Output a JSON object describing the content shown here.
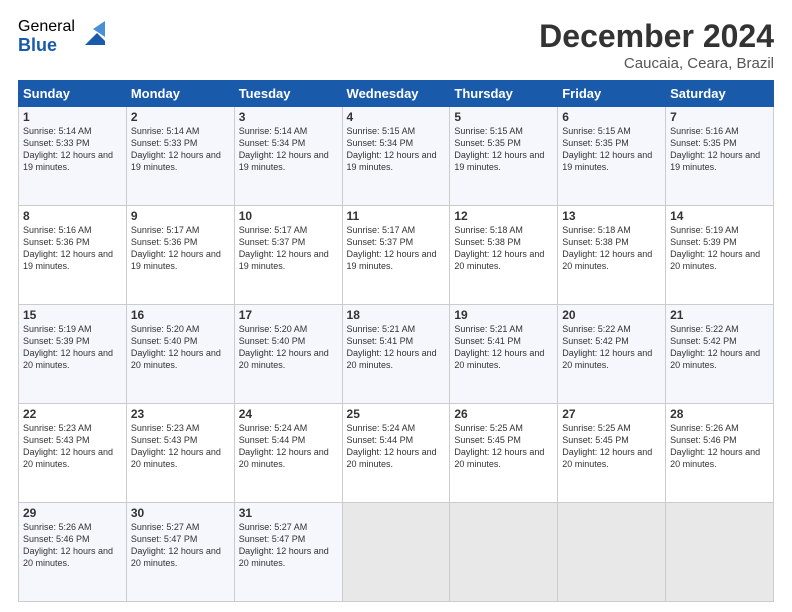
{
  "logo": {
    "general": "General",
    "blue": "Blue"
  },
  "title": "December 2024",
  "location": "Caucaia, Ceara, Brazil",
  "days_of_week": [
    "Sunday",
    "Monday",
    "Tuesday",
    "Wednesday",
    "Thursday",
    "Friday",
    "Saturday"
  ],
  "weeks": [
    [
      {
        "day": "1",
        "sunrise": "5:14 AM",
        "sunset": "5:33 PM",
        "daylight": "12 hours and 19 minutes."
      },
      {
        "day": "2",
        "sunrise": "5:14 AM",
        "sunset": "5:33 PM",
        "daylight": "12 hours and 19 minutes."
      },
      {
        "day": "3",
        "sunrise": "5:14 AM",
        "sunset": "5:34 PM",
        "daylight": "12 hours and 19 minutes."
      },
      {
        "day": "4",
        "sunrise": "5:15 AM",
        "sunset": "5:34 PM",
        "daylight": "12 hours and 19 minutes."
      },
      {
        "day": "5",
        "sunrise": "5:15 AM",
        "sunset": "5:35 PM",
        "daylight": "12 hours and 19 minutes."
      },
      {
        "day": "6",
        "sunrise": "5:15 AM",
        "sunset": "5:35 PM",
        "daylight": "12 hours and 19 minutes."
      },
      {
        "day": "7",
        "sunrise": "5:16 AM",
        "sunset": "5:35 PM",
        "daylight": "12 hours and 19 minutes."
      }
    ],
    [
      {
        "day": "8",
        "sunrise": "5:16 AM",
        "sunset": "5:36 PM",
        "daylight": "12 hours and 19 minutes."
      },
      {
        "day": "9",
        "sunrise": "5:17 AM",
        "sunset": "5:36 PM",
        "daylight": "12 hours and 19 minutes."
      },
      {
        "day": "10",
        "sunrise": "5:17 AM",
        "sunset": "5:37 PM",
        "daylight": "12 hours and 19 minutes."
      },
      {
        "day": "11",
        "sunrise": "5:17 AM",
        "sunset": "5:37 PM",
        "daylight": "12 hours and 19 minutes."
      },
      {
        "day": "12",
        "sunrise": "5:18 AM",
        "sunset": "5:38 PM",
        "daylight": "12 hours and 20 minutes."
      },
      {
        "day": "13",
        "sunrise": "5:18 AM",
        "sunset": "5:38 PM",
        "daylight": "12 hours and 20 minutes."
      },
      {
        "day": "14",
        "sunrise": "5:19 AM",
        "sunset": "5:39 PM",
        "daylight": "12 hours and 20 minutes."
      }
    ],
    [
      {
        "day": "15",
        "sunrise": "5:19 AM",
        "sunset": "5:39 PM",
        "daylight": "12 hours and 20 minutes."
      },
      {
        "day": "16",
        "sunrise": "5:20 AM",
        "sunset": "5:40 PM",
        "daylight": "12 hours and 20 minutes."
      },
      {
        "day": "17",
        "sunrise": "5:20 AM",
        "sunset": "5:40 PM",
        "daylight": "12 hours and 20 minutes."
      },
      {
        "day": "18",
        "sunrise": "5:21 AM",
        "sunset": "5:41 PM",
        "daylight": "12 hours and 20 minutes."
      },
      {
        "day": "19",
        "sunrise": "5:21 AM",
        "sunset": "5:41 PM",
        "daylight": "12 hours and 20 minutes."
      },
      {
        "day": "20",
        "sunrise": "5:22 AM",
        "sunset": "5:42 PM",
        "daylight": "12 hours and 20 minutes."
      },
      {
        "day": "21",
        "sunrise": "5:22 AM",
        "sunset": "5:42 PM",
        "daylight": "12 hours and 20 minutes."
      }
    ],
    [
      {
        "day": "22",
        "sunrise": "5:23 AM",
        "sunset": "5:43 PM",
        "daylight": "12 hours and 20 minutes."
      },
      {
        "day": "23",
        "sunrise": "5:23 AM",
        "sunset": "5:43 PM",
        "daylight": "12 hours and 20 minutes."
      },
      {
        "day": "24",
        "sunrise": "5:24 AM",
        "sunset": "5:44 PM",
        "daylight": "12 hours and 20 minutes."
      },
      {
        "day": "25",
        "sunrise": "5:24 AM",
        "sunset": "5:44 PM",
        "daylight": "12 hours and 20 minutes."
      },
      {
        "day": "26",
        "sunrise": "5:25 AM",
        "sunset": "5:45 PM",
        "daylight": "12 hours and 20 minutes."
      },
      {
        "day": "27",
        "sunrise": "5:25 AM",
        "sunset": "5:45 PM",
        "daylight": "12 hours and 20 minutes."
      },
      {
        "day": "28",
        "sunrise": "5:26 AM",
        "sunset": "5:46 PM",
        "daylight": "12 hours and 20 minutes."
      }
    ],
    [
      {
        "day": "29",
        "sunrise": "5:26 AM",
        "sunset": "5:46 PM",
        "daylight": "12 hours and 20 minutes."
      },
      {
        "day": "30",
        "sunrise": "5:27 AM",
        "sunset": "5:47 PM",
        "daylight": "12 hours and 20 minutes."
      },
      {
        "day": "31",
        "sunrise": "5:27 AM",
        "sunset": "5:47 PM",
        "daylight": "12 hours and 20 minutes."
      },
      null,
      null,
      null,
      null
    ]
  ]
}
